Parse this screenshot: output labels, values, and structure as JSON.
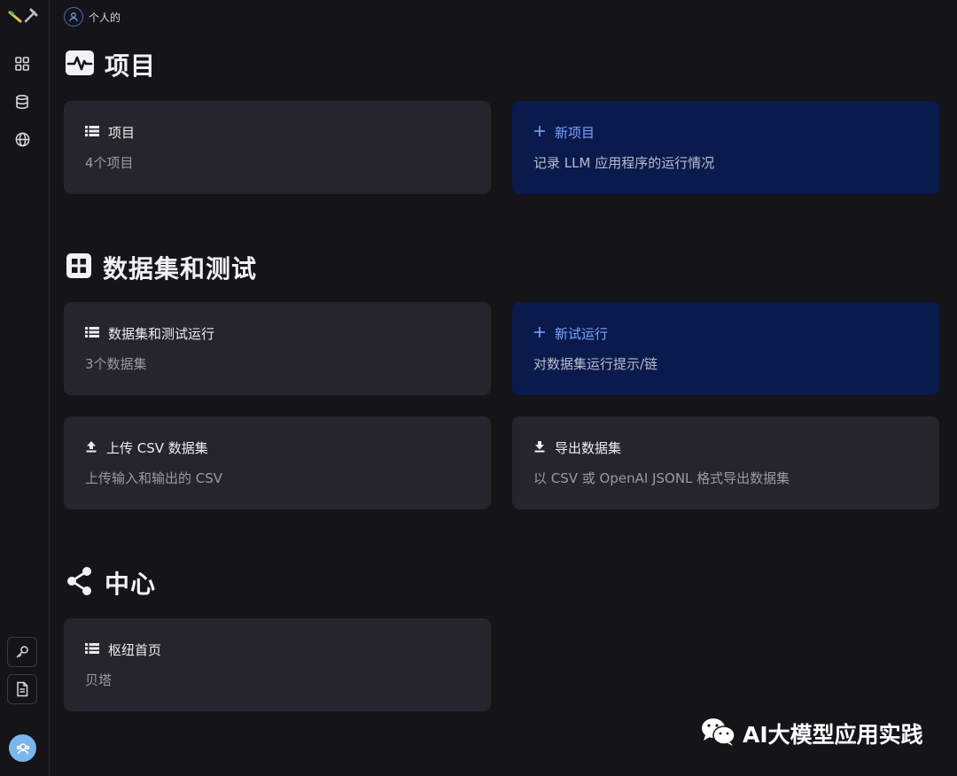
{
  "header": {
    "org_label": "个人的"
  },
  "sections": {
    "projects": {
      "title": "项目",
      "cards": [
        {
          "label": "项目",
          "sub": "4个项目"
        },
        {
          "label": "新项目",
          "sub": "记录 LLM 应用程序的运行情况"
        }
      ]
    },
    "datasets": {
      "title": "数据集和测试",
      "cards": [
        {
          "label": "数据集和测试运行",
          "sub": "3个数据集"
        },
        {
          "label": "新试运行",
          "sub": "对数据集运行提示/链"
        },
        {
          "label": "上传 CSV 数据集",
          "sub": "上传输入和输出的 CSV"
        },
        {
          "label": "导出数据集",
          "sub": "以 CSV 或 OpenAI JSONL 格式导出数据集"
        }
      ]
    },
    "hub": {
      "title": "中心",
      "cards": [
        {
          "label": "枢纽首页",
          "sub": "贝塔"
        }
      ]
    }
  },
  "watermark": {
    "text": "AI大模型应用实践"
  },
  "colors": {
    "accent": "#7aa2ff",
    "card": "#25252d",
    "card_blue": "#0b1a4d",
    "background": "#141419"
  },
  "icons": [
    "grid-icon",
    "database-icon",
    "globe-icon",
    "key-icon",
    "document-icon",
    "list-icon",
    "plus-icon",
    "upload-icon",
    "download-icon",
    "share-icon",
    "activity-icon",
    "table-icon",
    "user-icon"
  ]
}
